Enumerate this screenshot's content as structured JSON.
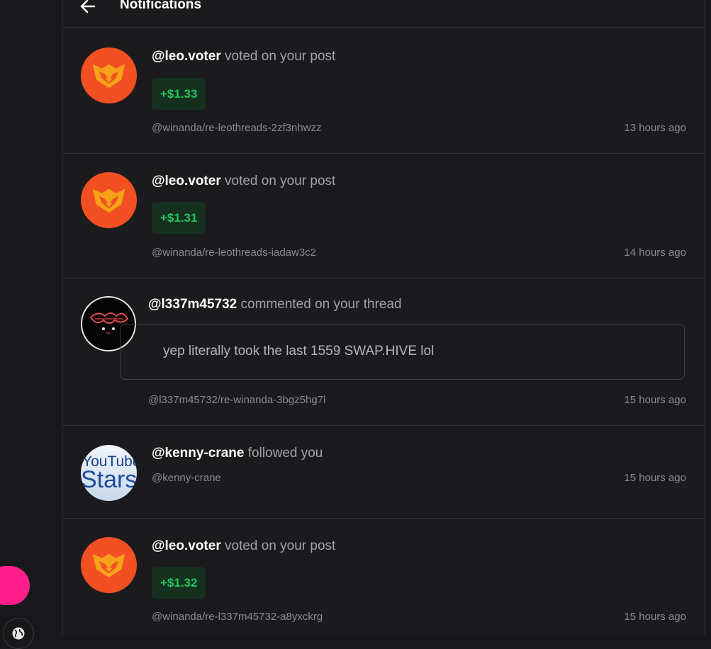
{
  "header": {
    "title": "Notifications",
    "back_icon": "arrow-left-icon"
  },
  "colors": {
    "background": "#18181b",
    "accent_pink": "#ff1f8c",
    "amount_green": "#22c55e",
    "leo_orange": "#f25022"
  },
  "notifications": [
    {
      "user": "@leo.voter",
      "action": "voted on your post",
      "amount": "+$1.33",
      "link": "@winanda/re-leothreads-2zf3nhwzz",
      "time": "13 hours ago",
      "avatar": "leo-lion-icon"
    },
    {
      "user": "@leo.voter",
      "action": "voted on your post",
      "amount": "+$1.31",
      "link": "@winanda/re-leothreads-iadaw3c2",
      "time": "14 hours ago",
      "avatar": "leo-lion-icon"
    },
    {
      "user": "@l337m45732",
      "action": "commented on your thread",
      "comment": "yep literally took the last 1559 SWAP.HIVE lol",
      "link": "@l337m45732/re-winanda-3bgz5hg7l",
      "time": "15 hours ago",
      "avatar": "red-glow-avatar"
    },
    {
      "user": "@kenny-crane",
      "action": "followed you",
      "link": "@kenny-crane",
      "time": "15 hours ago",
      "avatar": "youtube-stars-avatar",
      "avatar_text_1": "YouTube",
      "avatar_text_2": "Stars"
    },
    {
      "user": "@leo.voter",
      "action": "voted on your post",
      "amount": "+$1.32",
      "link": "@winanda/re-l337m45732-a8yxckrg",
      "time": "15 hours ago",
      "avatar": "leo-lion-icon"
    }
  ]
}
